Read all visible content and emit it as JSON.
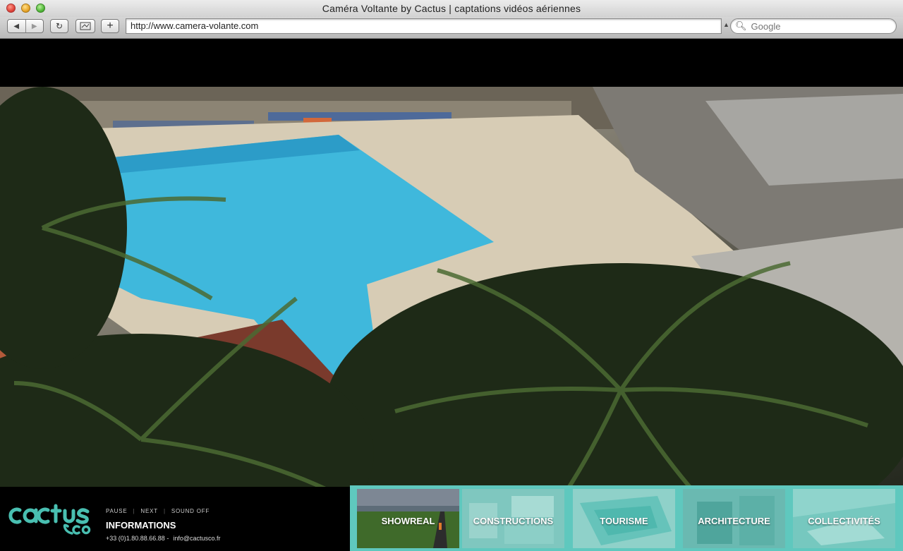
{
  "window": {
    "title": "Caméra Voltante by Cactus | captations vidéos aériennes"
  },
  "toolbar": {
    "url": "http://www.camera-volante.com",
    "search_placeholder": "Google"
  },
  "player": {
    "pause_label": "PAUSE",
    "next_label": "NEXT",
    "sound_label": "SOUND OFF"
  },
  "footer": {
    "info_title": "INFORMATIONS",
    "phone": "+33 (0)1.80.88.66.88 -",
    "email": "info@cactusco.fr"
  },
  "categories": [
    {
      "label": "SHOWREAL"
    },
    {
      "label": "CONSTRUCTIONS"
    },
    {
      "label": "TOURISME"
    },
    {
      "label": "ARCHITECTURE"
    },
    {
      "label": "COLLECTIVITÉS"
    }
  ],
  "colors": {
    "accent": "#5fc8be",
    "logo": "#49bfb1"
  }
}
